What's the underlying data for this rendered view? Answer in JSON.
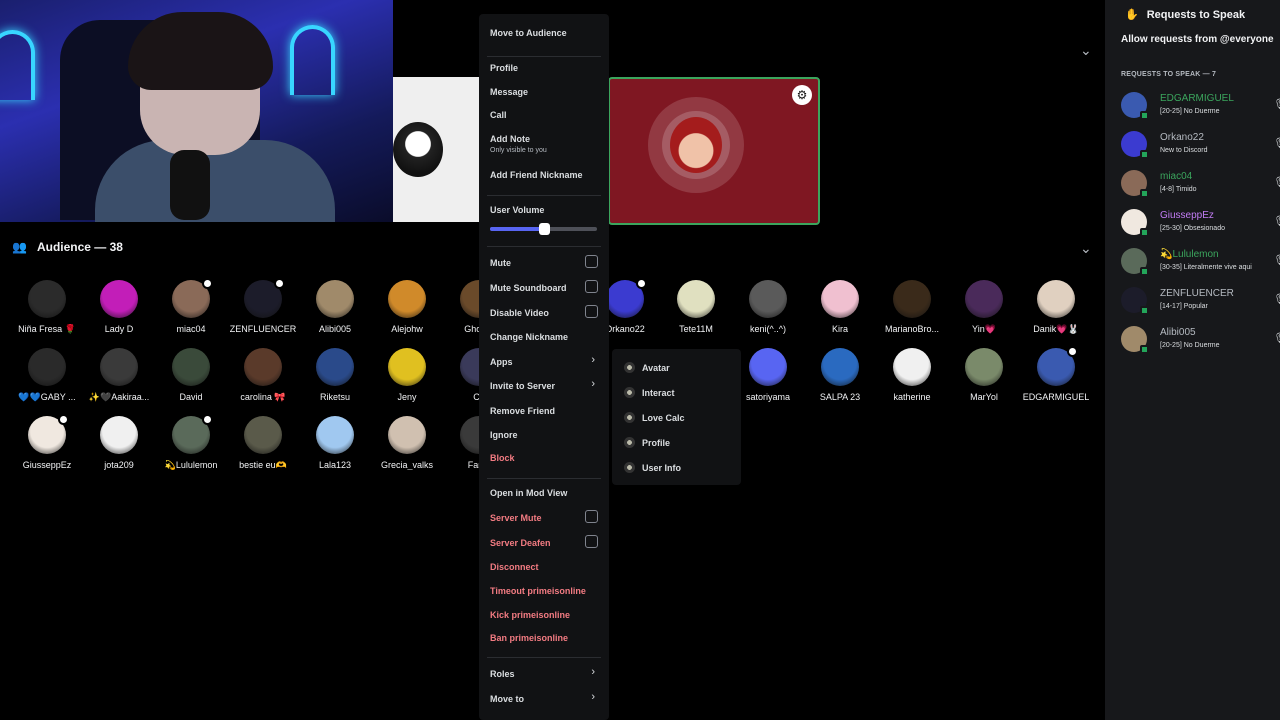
{
  "stage": {
    "audience_header": "Audience — 38"
  },
  "audience": [
    {
      "name": "Niña Fresa 🌹",
      "color": "#2b2b2b"
    },
    {
      "name": "Lady D",
      "color": "#c21eb8"
    },
    {
      "name": "miac04",
      "color": "#8a6a58"
    },
    {
      "name": "ZENFLUENCER",
      "color": "#1c1c2a"
    },
    {
      "name": "Alibi005",
      "color": "#a08a6a"
    },
    {
      "name": "Alejohw",
      "color": "#d08a2a"
    },
    {
      "name": "GhostF",
      "color": "#6a4a2a"
    },
    {
      "name": "Orkano22",
      "color": "#3b3bd0"
    },
    {
      "name": "Tete11M",
      "color": "#e0e0c0"
    },
    {
      "name": "keni(^..^)",
      "color": "#5a5a5a"
    },
    {
      "name": "Kira",
      "color": "#f0c0d0"
    },
    {
      "name": "MarianoBro...",
      "color": "#3a2a1a"
    },
    {
      "name": "Yin💗",
      "color": "#4a2a5a"
    },
    {
      "name": "Danik💗🐰",
      "color": "#e0d0c0"
    },
    {
      "name": "💙💙GABY ...",
      "color": "#2a2a2a"
    },
    {
      "name": "✨🖤Aakiraa...",
      "color": "#3a3a3a"
    },
    {
      "name": "David",
      "color": "#3a4a3a"
    },
    {
      "name": "carolina 🎀",
      "color": "#5a3a2a"
    },
    {
      "name": "Riketsu",
      "color": "#2a4a8a"
    },
    {
      "name": "Jeny",
      "color": "#e0c020"
    },
    {
      "name": "Ca",
      "color": "#3a3a5a"
    },
    {
      "name": "satoriyama",
      "color": "#5865f2"
    },
    {
      "name": "SALPA 23",
      "color": "#2a6ac0"
    },
    {
      "name": "katherine",
      "color": "#f0f0f0"
    },
    {
      "name": "MarYol",
      "color": "#7a8a6a"
    },
    {
      "name": "EDGARMIGUEL",
      "color": "#3a5ab0"
    },
    {
      "name": "GiusseppEz",
      "color": "#f0e8e0"
    },
    {
      "name": "jota209",
      "color": "#f0f0f0"
    },
    {
      "name": "💫Lululemon",
      "color": "#5a6a5a"
    },
    {
      "name": "bestie eu🫶",
      "color": "#5a5a4a"
    },
    {
      "name": "Lala123",
      "color": "#a0c8f0"
    },
    {
      "name": "Grecia_valks",
      "color": "#d0c0b0"
    },
    {
      "name": "Famy",
      "color": "#3a3a3a"
    }
  ],
  "context_menu": {
    "move_to_audience": "Move to Audience",
    "profile": "Profile",
    "message": "Message",
    "call": "Call",
    "add_note": "Add Note",
    "add_note_sub": "Only visible to you",
    "add_friend_nickname": "Add Friend Nickname",
    "user_volume": "User Volume",
    "user_volume_value": 0.5,
    "mute": "Mute",
    "mute_soundboard": "Mute Soundboard",
    "disable_video": "Disable Video",
    "change_nickname": "Change Nickname",
    "apps": "Apps",
    "invite_to_server": "Invite to Server",
    "remove_friend": "Remove Friend",
    "ignore": "Ignore",
    "block": "Block",
    "open_in_mod_view": "Open in Mod View",
    "server_mute": "Server Mute",
    "server_deafen": "Server Deafen",
    "disconnect": "Disconnect",
    "timeout": "Timeout primeisonline",
    "kick": "Kick primeisonline",
    "ban": "Ban primeisonline",
    "roles": "Roles",
    "move_to": "Move to"
  },
  "apps_submenu": [
    "Avatar",
    "Interact",
    "Love Calc",
    "Profile",
    "User Info"
  ],
  "sidebar": {
    "title": "Requests to Speak",
    "allow": "Allow requests from @everyone",
    "section": "REQUESTS TO SPEAK — 7",
    "requests": [
      {
        "name": "EDGARMIGUEL",
        "desc": "[20-25] No Duerme",
        "name_color": "#3ba55d",
        "av": "#3a5ab0"
      },
      {
        "name": "Orkano22",
        "desc": "New to Discord",
        "name_color": "#b5bac1",
        "av": "#3b3bd0"
      },
      {
        "name": "miac04",
        "desc": "[4-8] Timido",
        "name_color": "#3ba55d",
        "av": "#8a6a58"
      },
      {
        "name": "GiusseppEz",
        "desc": "[25-30] Obsesionado",
        "name_color": "#c27cf5",
        "av": "#f0e8e0"
      },
      {
        "name": "💫Lululemon",
        "desc": "[30-35] Literalmente vive aqui",
        "name_color": "#3ba55d",
        "av": "#5a6a5a"
      },
      {
        "name": "ZENFLUENCER",
        "desc": "[14-17] Popular",
        "name_color": "#b5bac1",
        "av": "#1c1c2a"
      },
      {
        "name": "Alibi005",
        "desc": "[20-25] No Duerme",
        "name_color": "#b5bac1",
        "av": "#a08a6a"
      }
    ]
  }
}
